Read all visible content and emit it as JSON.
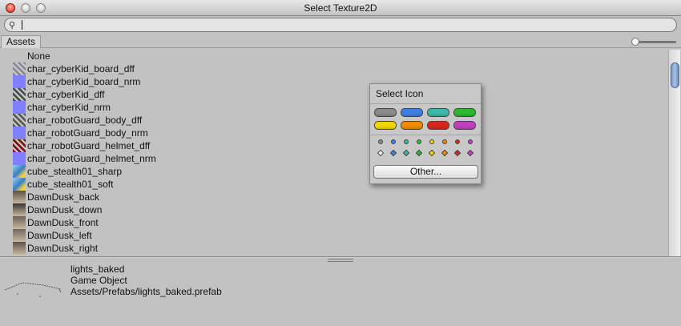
{
  "window": {
    "title": "Select Texture2D"
  },
  "search": {
    "value": ""
  },
  "tabs": [
    {
      "label": "Assets"
    }
  ],
  "list": [
    {
      "label": "None",
      "icon": "none",
      "color": ""
    },
    {
      "label": "char_cyberKid_board_dff",
      "icon": "texture-thumbnail",
      "color": "#8a8a9a"
    },
    {
      "label": "char_cyberKid_board_nrm",
      "icon": "normal-map-thumbnail",
      "color": "#8080ff"
    },
    {
      "label": "char_cyberKid_dff",
      "icon": "texture-thumbnail",
      "color": "#4a5058"
    },
    {
      "label": "char_cyberKid_nrm",
      "icon": "normal-map-thumbnail",
      "color": "#8080ff"
    },
    {
      "label": "char_robotGuard_body_dff",
      "icon": "texture-thumbnail",
      "color": "#5a5a5a"
    },
    {
      "label": "char_robotGuard_body_nrm",
      "icon": "normal-map-thumbnail",
      "color": "#8080ff"
    },
    {
      "label": "char_robotGuard_helmet_dff",
      "icon": "texture-thumbnail",
      "color": "#7a1a10"
    },
    {
      "label": "char_robotGuard_helmet_nrm",
      "icon": "normal-map-thumbnail",
      "color": "#8080ff"
    },
    {
      "label": "cube_stealth01_sharp",
      "icon": "cube-thumbnail",
      "color": "#4a9ad0"
    },
    {
      "label": "cube_stealth01_soft",
      "icon": "cube-thumbnail",
      "color": "#4a9ad0"
    },
    {
      "label": "DawnDusk_back",
      "icon": "skybox-thumbnail",
      "color": "#5a5048"
    },
    {
      "label": "DawnDusk_down",
      "icon": "skybox-thumbnail",
      "color": "#3a3634"
    },
    {
      "label": "DawnDusk_front",
      "icon": "skybox-thumbnail",
      "color": "#6a6058"
    },
    {
      "label": "DawnDusk_left",
      "icon": "skybox-thumbnail",
      "color": "#70665a"
    },
    {
      "label": "DawnDusk_right",
      "icon": "skybox-thumbnail",
      "color": "#5e5248"
    }
  ],
  "preview": {
    "name": "lights_baked",
    "type": "Game Object",
    "path": "Assets/Prefabs/lights_baked.prefab"
  },
  "icon_popup": {
    "title": "Select Icon",
    "colors": [
      "#8a8a8a",
      "#3f7fe0",
      "#3cb8a8",
      "#2eb82e",
      "#f2d600",
      "#f08a00",
      "#d8281e",
      "#c040c0"
    ],
    "other_label": "Other..."
  }
}
